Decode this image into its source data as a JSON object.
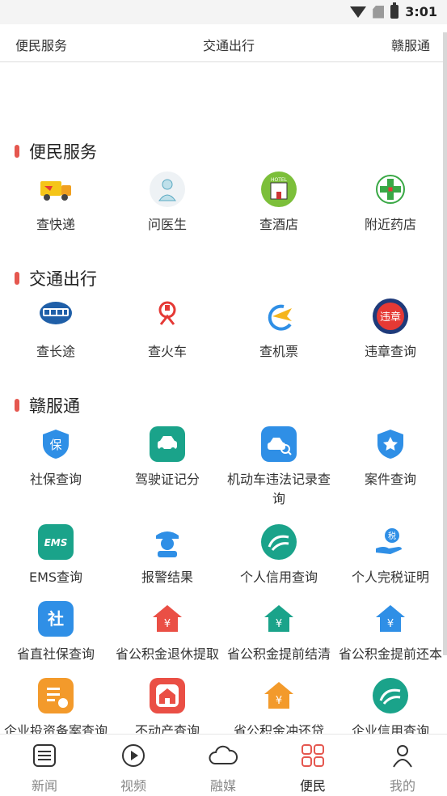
{
  "status": {
    "time": "3:01"
  },
  "tabs": [
    "便民服务",
    "交通出行",
    "赣服通"
  ],
  "sections": [
    {
      "title": "便民服务",
      "items": [
        {
          "label": "查快递",
          "icon": "delivery-truck-icon"
        },
        {
          "label": "问医生",
          "icon": "doctor-icon"
        },
        {
          "label": "查酒店",
          "icon": "hotel-icon"
        },
        {
          "label": "附近药店",
          "icon": "pharmacy-icon"
        }
      ]
    },
    {
      "title": "交通出行",
      "items": [
        {
          "label": "查长途",
          "icon": "bus-icon"
        },
        {
          "label": "查火车",
          "icon": "train-icon"
        },
        {
          "label": "查机票",
          "icon": "airplane-icon"
        },
        {
          "label": "违章查询",
          "icon": "violation-icon"
        }
      ]
    },
    {
      "title": "赣服通",
      "items": [
        {
          "label": "社保查询",
          "icon": "shield-bao-icon"
        },
        {
          "label": "驾驶证记分",
          "icon": "car-icon"
        },
        {
          "label": "机动车违法记录查询",
          "icon": "car-search-icon"
        },
        {
          "label": "案件查询",
          "icon": "police-badge-icon"
        },
        {
          "label": "EMS查询",
          "icon": "ems-icon"
        },
        {
          "label": "报警结果",
          "icon": "police-officer-icon"
        },
        {
          "label": "个人信用查询",
          "icon": "credit-icon"
        },
        {
          "label": "个人完税证明",
          "icon": "tax-hand-icon"
        },
        {
          "label": "省直社保查询",
          "icon": "social-security-icon"
        },
        {
          "label": "省公积金退休提取",
          "icon": "house-fund-icon"
        },
        {
          "label": "省公积金提前结清",
          "icon": "house-fund-icon"
        },
        {
          "label": "省公积金提前还本",
          "icon": "house-fund-icon"
        },
        {
          "label": "企业投资备案查询",
          "icon": "enterprise-icon"
        },
        {
          "label": "不动产查询",
          "icon": "real-estate-icon"
        },
        {
          "label": "省公积金冲还贷",
          "icon": "house-fund-icon"
        },
        {
          "label": "企业信用查询",
          "icon": "credit-icon"
        }
      ]
    }
  ],
  "bao_char": "保",
  "she_char": "社",
  "yuan_char": "¥",
  "ems_text": "EMS",
  "hotel_text": "HOTEL",
  "violation_text": "违章",
  "tax_text": "税",
  "bottom_nav": [
    {
      "label": "新闻",
      "icon": "news-icon"
    },
    {
      "label": "视频",
      "icon": "video-icon"
    },
    {
      "label": "融媒",
      "icon": "cloud-icon"
    },
    {
      "label": "便民",
      "icon": "grid-icon"
    },
    {
      "label": "我的",
      "icon": "user-icon"
    }
  ],
  "colors": {
    "accent": "#e5574f",
    "blue": "#2f8fe6",
    "teal": "#1aa38a",
    "orange": "#f39a2b",
    "red": "#ea4f45"
  }
}
